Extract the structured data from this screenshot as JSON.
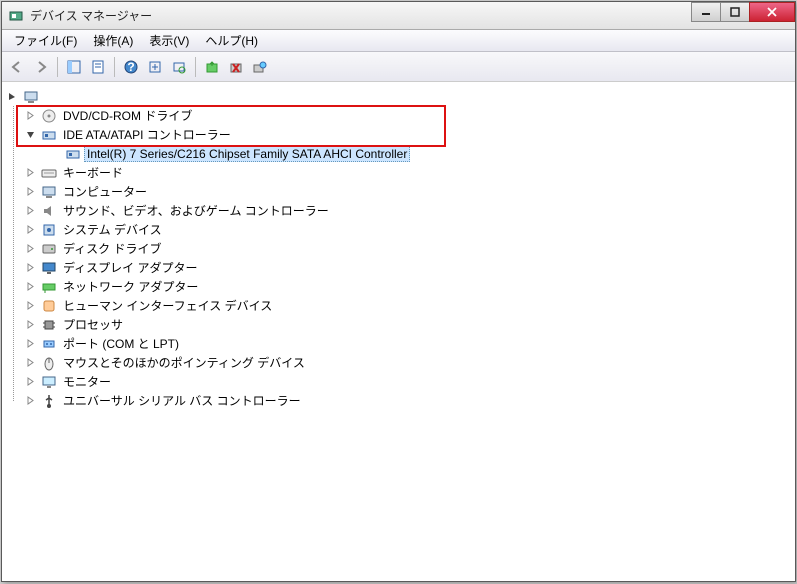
{
  "window": {
    "title": "デバイス マネージャー"
  },
  "menu": {
    "file": "ファイル(F)",
    "action": "操作(A)",
    "view": "表示(V)",
    "help": "ヘルプ(H)"
  },
  "tree": {
    "root_label": "",
    "categories": [
      {
        "label": "DVD/CD-ROM ドライブ",
        "expanded": false,
        "icon": "disc"
      },
      {
        "label": "IDE ATA/ATAPI コントローラー",
        "expanded": true,
        "icon": "controller",
        "children": [
          {
            "label": "Intel(R) 7 Series/C216 Chipset Family SATA AHCI Controller",
            "selected": true,
            "icon": "controller"
          }
        ]
      },
      {
        "label": "キーボード",
        "expanded": false,
        "icon": "keyboard"
      },
      {
        "label": "コンピューター",
        "expanded": false,
        "icon": "computer"
      },
      {
        "label": "サウンド、ビデオ、およびゲーム コントローラー",
        "expanded": false,
        "icon": "sound"
      },
      {
        "label": "システム デバイス",
        "expanded": false,
        "icon": "system"
      },
      {
        "label": "ディスク ドライブ",
        "expanded": false,
        "icon": "disk"
      },
      {
        "label": "ディスプレイ アダプター",
        "expanded": false,
        "icon": "display"
      },
      {
        "label": "ネットワーク アダプター",
        "expanded": false,
        "icon": "network"
      },
      {
        "label": "ヒューマン インターフェイス デバイス",
        "expanded": false,
        "icon": "hid"
      },
      {
        "label": "プロセッサ",
        "expanded": false,
        "icon": "cpu"
      },
      {
        "label": "ポート (COM と LPT)",
        "expanded": false,
        "icon": "port"
      },
      {
        "label": "マウスとそのほかのポインティング デバイス",
        "expanded": false,
        "icon": "mouse"
      },
      {
        "label": "モニター",
        "expanded": false,
        "icon": "monitor"
      },
      {
        "label": "ユニバーサル シリアル バス コントローラー",
        "expanded": false,
        "icon": "usb"
      }
    ]
  }
}
